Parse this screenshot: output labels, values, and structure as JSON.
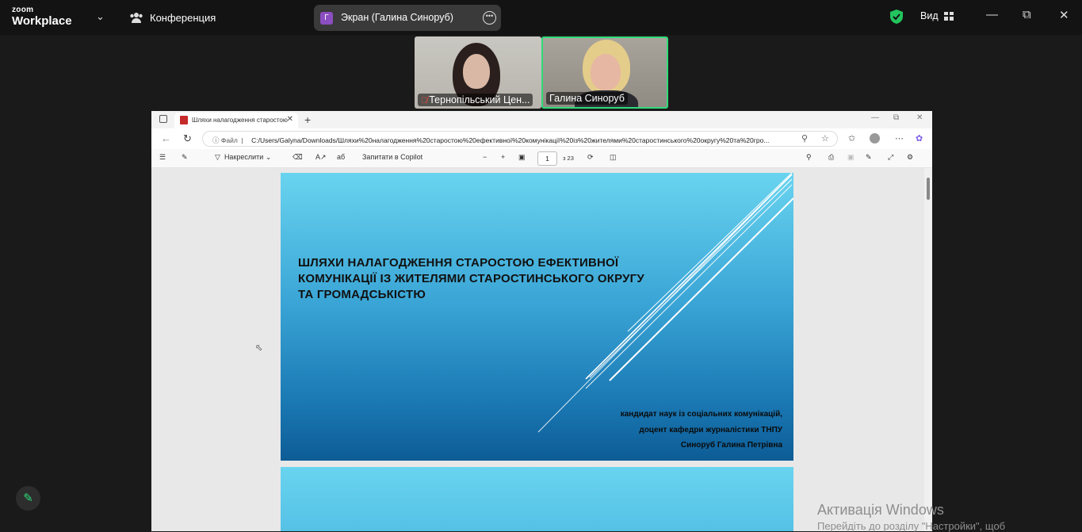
{
  "app": {
    "logo_top": "zoom",
    "logo_bottom": "Workplace",
    "menu_label": "Конференция"
  },
  "screen_share": {
    "avatar_letter": "Г",
    "label": "Экран (Галина Синоруб)"
  },
  "view": {
    "label": "Вид"
  },
  "participants": [
    {
      "name": "Тернопільський Цен..."
    },
    {
      "name": "Галина Синоруб"
    }
  ],
  "browser": {
    "tab_title": "Шляхи налагодження старостою",
    "address_prefix": "Файл",
    "address": "C:/Users/Galyna/Downloads/Шляхи%20налагодження%20старостою%20ефективної%20комунікації%20із%20жителями%20старостинського%20округу%20та%20гро...",
    "tools": {
      "draw_label": "Накреслити",
      "copilot_label": "Запитати в Copilot",
      "page_current": "1",
      "page_total": "з 23"
    }
  },
  "slide": {
    "title_lines": [
      "ШЛЯХИ НАЛАГОДЖЕННЯ СТАРОСТОЮ ЕФЕКТИВНОЇ",
      "КОМУНІКАЦІЇ ІЗ ЖИТЕЛЯМИ СТАРОСТИНСЬКОГО ОКРУГУ",
      "ТА ГРОМАДСЬКІСТЮ"
    ],
    "author_lines": [
      "кандидат наук із соціальних комунікацій,",
      "доцент кафедри журналістики ТНПУ",
      "Синоруб Галина Петрівна"
    ]
  },
  "windows_watermark": {
    "line1": "Активація Windows",
    "line2": "Перейдіть до розділу \"Настройки\", щоб"
  }
}
